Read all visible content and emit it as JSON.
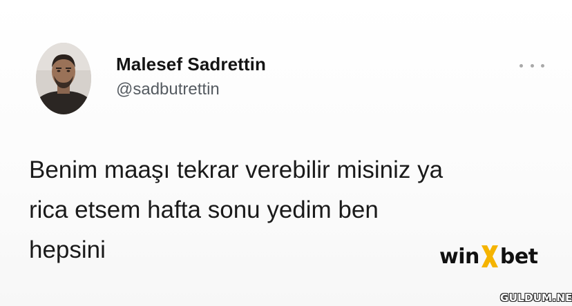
{
  "tweet": {
    "display_name": "Malesef Sadrettin",
    "handle": "@sadbutrettin",
    "text": "Benim maaşı tekrar verebilir misiniz ya\nrica etsem hafta sonu yedim ben\nhepsini",
    "more_icon": "more-horizontal-icon"
  },
  "brand_logo": {
    "part1": "win",
    "part2": "x",
    "part3": "bet",
    "accent_color": "#f5b400"
  },
  "watermark": {
    "text": "GULDUM.NET"
  },
  "colors": {
    "text_primary": "#141414",
    "text_secondary": "#555b61",
    "background": "#ffffff"
  }
}
